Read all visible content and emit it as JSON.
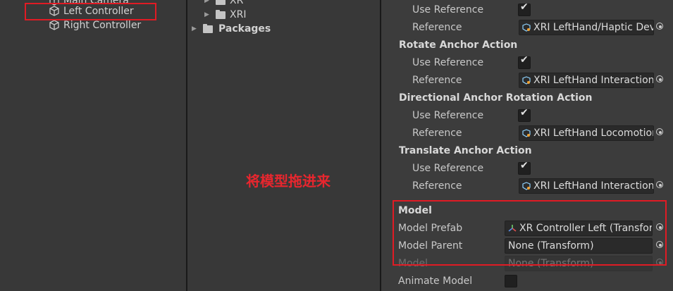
{
  "hierarchy": {
    "items": [
      {
        "label": "Main Camera",
        "icon": "gameobject-cube-icon"
      },
      {
        "label": "Left Controller",
        "icon": "gameobject-cube-icon"
      },
      {
        "label": "Right Controller",
        "icon": "gameobject-cube-icon"
      }
    ]
  },
  "project": {
    "items": [
      {
        "label": "XR",
        "icon": "folder-icon"
      },
      {
        "label": "XRI",
        "icon": "folder-icon"
      },
      {
        "label": "Packages",
        "icon": "folder-icon"
      }
    ]
  },
  "inspector": {
    "haptic": {
      "use_reference_label": "Use Reference",
      "reference_label": "Reference",
      "reference_value": "XRI LeftHand/Haptic Device"
    },
    "rotate": {
      "title": "Rotate Anchor Action",
      "use_reference_label": "Use Reference",
      "reference_label": "Reference",
      "reference_value": "XRI LeftHand Interaction/Rotate Anchor"
    },
    "directional": {
      "title": "Directional Anchor Rotation Action",
      "use_reference_label": "Use Reference",
      "reference_label": "Reference",
      "reference_value": "XRI LeftHand Locomotion/Directional Anchor Rotation"
    },
    "translate": {
      "title": "Translate Anchor Action",
      "use_reference_label": "Use Reference",
      "reference_label": "Reference",
      "reference_value": "XRI LeftHand Interaction/Translate Anchor"
    },
    "model": {
      "title": "Model",
      "prefab_label": "Model Prefab",
      "prefab_value": "XR Controller Left (Transform)",
      "parent_label": "Model Parent",
      "parent_value": "None (Transform)",
      "model_label": "Model",
      "model_value": "None (Transform)",
      "animate_label": "Animate Model"
    }
  },
  "annotation": {
    "text": "将模型拖进来",
    "color": "#e01b24"
  }
}
